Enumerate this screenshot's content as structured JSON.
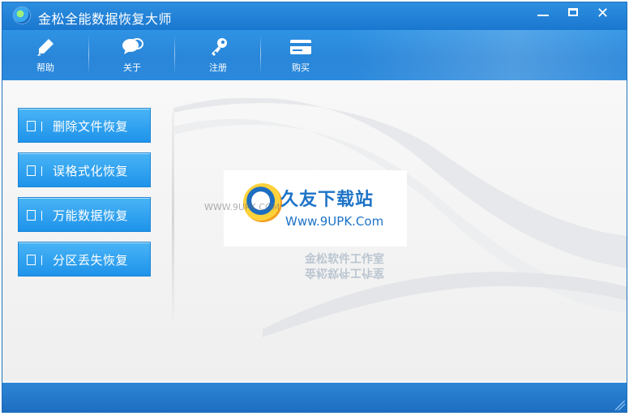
{
  "window": {
    "title": "金松全能数据恢复大师"
  },
  "window_controls": [
    "minimize-icon",
    "maximize-icon",
    "close-icon"
  ],
  "toolbar": {
    "items": [
      {
        "label": "帮助",
        "icon": "pen-icon"
      },
      {
        "label": "关于",
        "icon": "chat-bubbles-icon"
      },
      {
        "label": "注册",
        "icon": "key-icon"
      },
      {
        "label": "购买",
        "icon": "card-icon"
      }
    ]
  },
  "sidebar": {
    "items": [
      {
        "label": "删除文件恢复",
        "icon": "trash-icon"
      },
      {
        "label": "误格式化恢复",
        "icon": "format-icon"
      },
      {
        "label": "万能数据恢复",
        "icon": "document-icon"
      },
      {
        "label": "分区丢失恢复",
        "icon": "partition-icon"
      }
    ]
  },
  "watermark": {
    "title": "久友下载站",
    "url": "Www.9UPK.Com",
    "url_faint": "WWW.9UPK.COM",
    "studio": "金松软件工作室"
  },
  "colors": {
    "accent": "#2a86d9",
    "button_top": "#49b4f6",
    "button_bottom": "#1e93ea",
    "footer": "#2477c8",
    "watermark_text": "#1d73c7"
  }
}
